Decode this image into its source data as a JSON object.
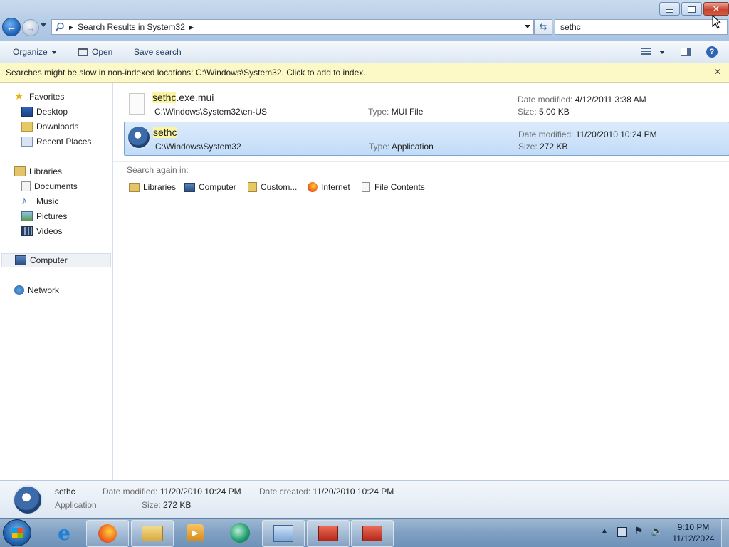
{
  "window": {
    "breadcrumb": "Search Results in System32",
    "search_value": "sethc"
  },
  "toolbar": {
    "organize_label": "Organize",
    "open_label": "Open",
    "save_search_label": "Save search"
  },
  "infobar": {
    "message": "Searches might be slow in non-indexed locations: C:\\Windows\\System32. Click to add to index..."
  },
  "nav": {
    "favorites": "Favorites",
    "desktop": "Desktop",
    "downloads": "Downloads",
    "recent_places": "Recent Places",
    "libraries": "Libraries",
    "documents": "Documents",
    "music": "Music",
    "pictures": "Pictures",
    "videos": "Videos",
    "computer": "Computer",
    "network": "Network"
  },
  "results": [
    {
      "name_highlight": "sethc",
      "name_rest": ".exe.mui",
      "path": "C:\\Windows\\System32\\en-US",
      "type_label": "Type:",
      "type_value": "MUI File",
      "date_label": "Date modified:",
      "date_value": "4/12/2011 3:38 AM",
      "size_label": "Size:",
      "size_value": "5.00 KB"
    },
    {
      "name_highlight": "sethc",
      "name_rest": "",
      "path": "C:\\Windows\\System32",
      "type_label": "Type:",
      "type_value": "Application",
      "date_label": "Date modified:",
      "date_value": "11/20/2010 10:24 PM",
      "size_label": "Size:",
      "size_value": "272 KB"
    }
  ],
  "search_again": {
    "label": "Search again in:",
    "libraries": "Libraries",
    "computer": "Computer",
    "custom": "Custom...",
    "internet": "Internet",
    "file_contents": "File Contents"
  },
  "details": {
    "name": "sethc",
    "kind": "Application",
    "date_modified_label": "Date modified:",
    "date_modified_value": "11/20/2010 10:24 PM",
    "date_created_label": "Date created:",
    "date_created_value": "11/20/2010 10:24 PM",
    "size_label": "Size:",
    "size_value": "272 KB"
  },
  "taskbar": {
    "time": "9:10 PM",
    "date": "11/12/2024"
  },
  "colors": {
    "infobar_bg": "#fdf9c7",
    "selection_bg": "#c1dcf8",
    "highlight": "#fbf4a0"
  }
}
